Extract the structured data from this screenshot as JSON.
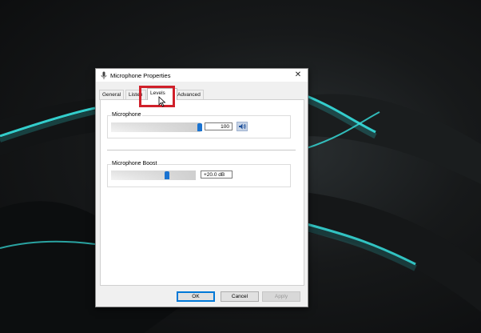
{
  "dialog": {
    "title": "Microphone Properties",
    "close_glyph": "✕",
    "tabs": [
      {
        "label": "General"
      },
      {
        "label": "Listen"
      },
      {
        "label": "Levels"
      },
      {
        "label": "Advanced"
      }
    ],
    "active_tab": "Levels",
    "microphone": {
      "label": "Microphone",
      "value": "100",
      "level_fraction": 1.0
    },
    "boost": {
      "label": "Microphone Boost",
      "value": "+20.0 dB",
      "level_fraction": 0.67
    },
    "buttons": {
      "ok": "OK",
      "cancel": "Cancel",
      "apply": "Apply"
    }
  },
  "colors": {
    "highlight": "#d0202a",
    "slider_thumb": "#1a73d1",
    "accent_glow": "#37e2e0"
  },
  "icons": [
    "microphone-icon",
    "close-icon",
    "speaker-icon",
    "mouse-cursor-icon"
  ]
}
